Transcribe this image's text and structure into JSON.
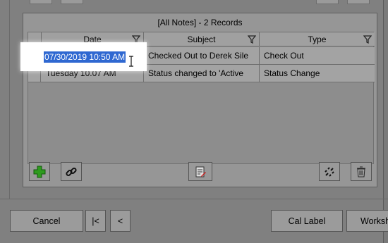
{
  "grid": {
    "title": "[All Notes] - 2 Records",
    "columns": [
      "Date",
      "Subject",
      "Type"
    ],
    "rows": [
      {
        "date": "07/30/2019 10:50 AM",
        "subject": "Checked Out to Derek Sile",
        "type": "Check Out"
      },
      {
        "date": "Tuesday 10.07 AM",
        "subject": "Status changed to 'Active",
        "type": "Status Change"
      }
    ]
  },
  "toolbar": {
    "add_icon": "plus-icon",
    "link_icon": "link-icon",
    "edit_icon": "edit-note-icon",
    "unlink_icon": "unlink-icon",
    "delete_icon": "trash-icon"
  },
  "bottom_bar": {
    "cancel_label": "Cancel",
    "first_label": "|<",
    "prev_label": "<",
    "cal_label": "Cal Label",
    "workshop_label": "Worksh"
  },
  "colors": {
    "selection": "#2f68d1",
    "plus_green": "#2e9b1e"
  }
}
